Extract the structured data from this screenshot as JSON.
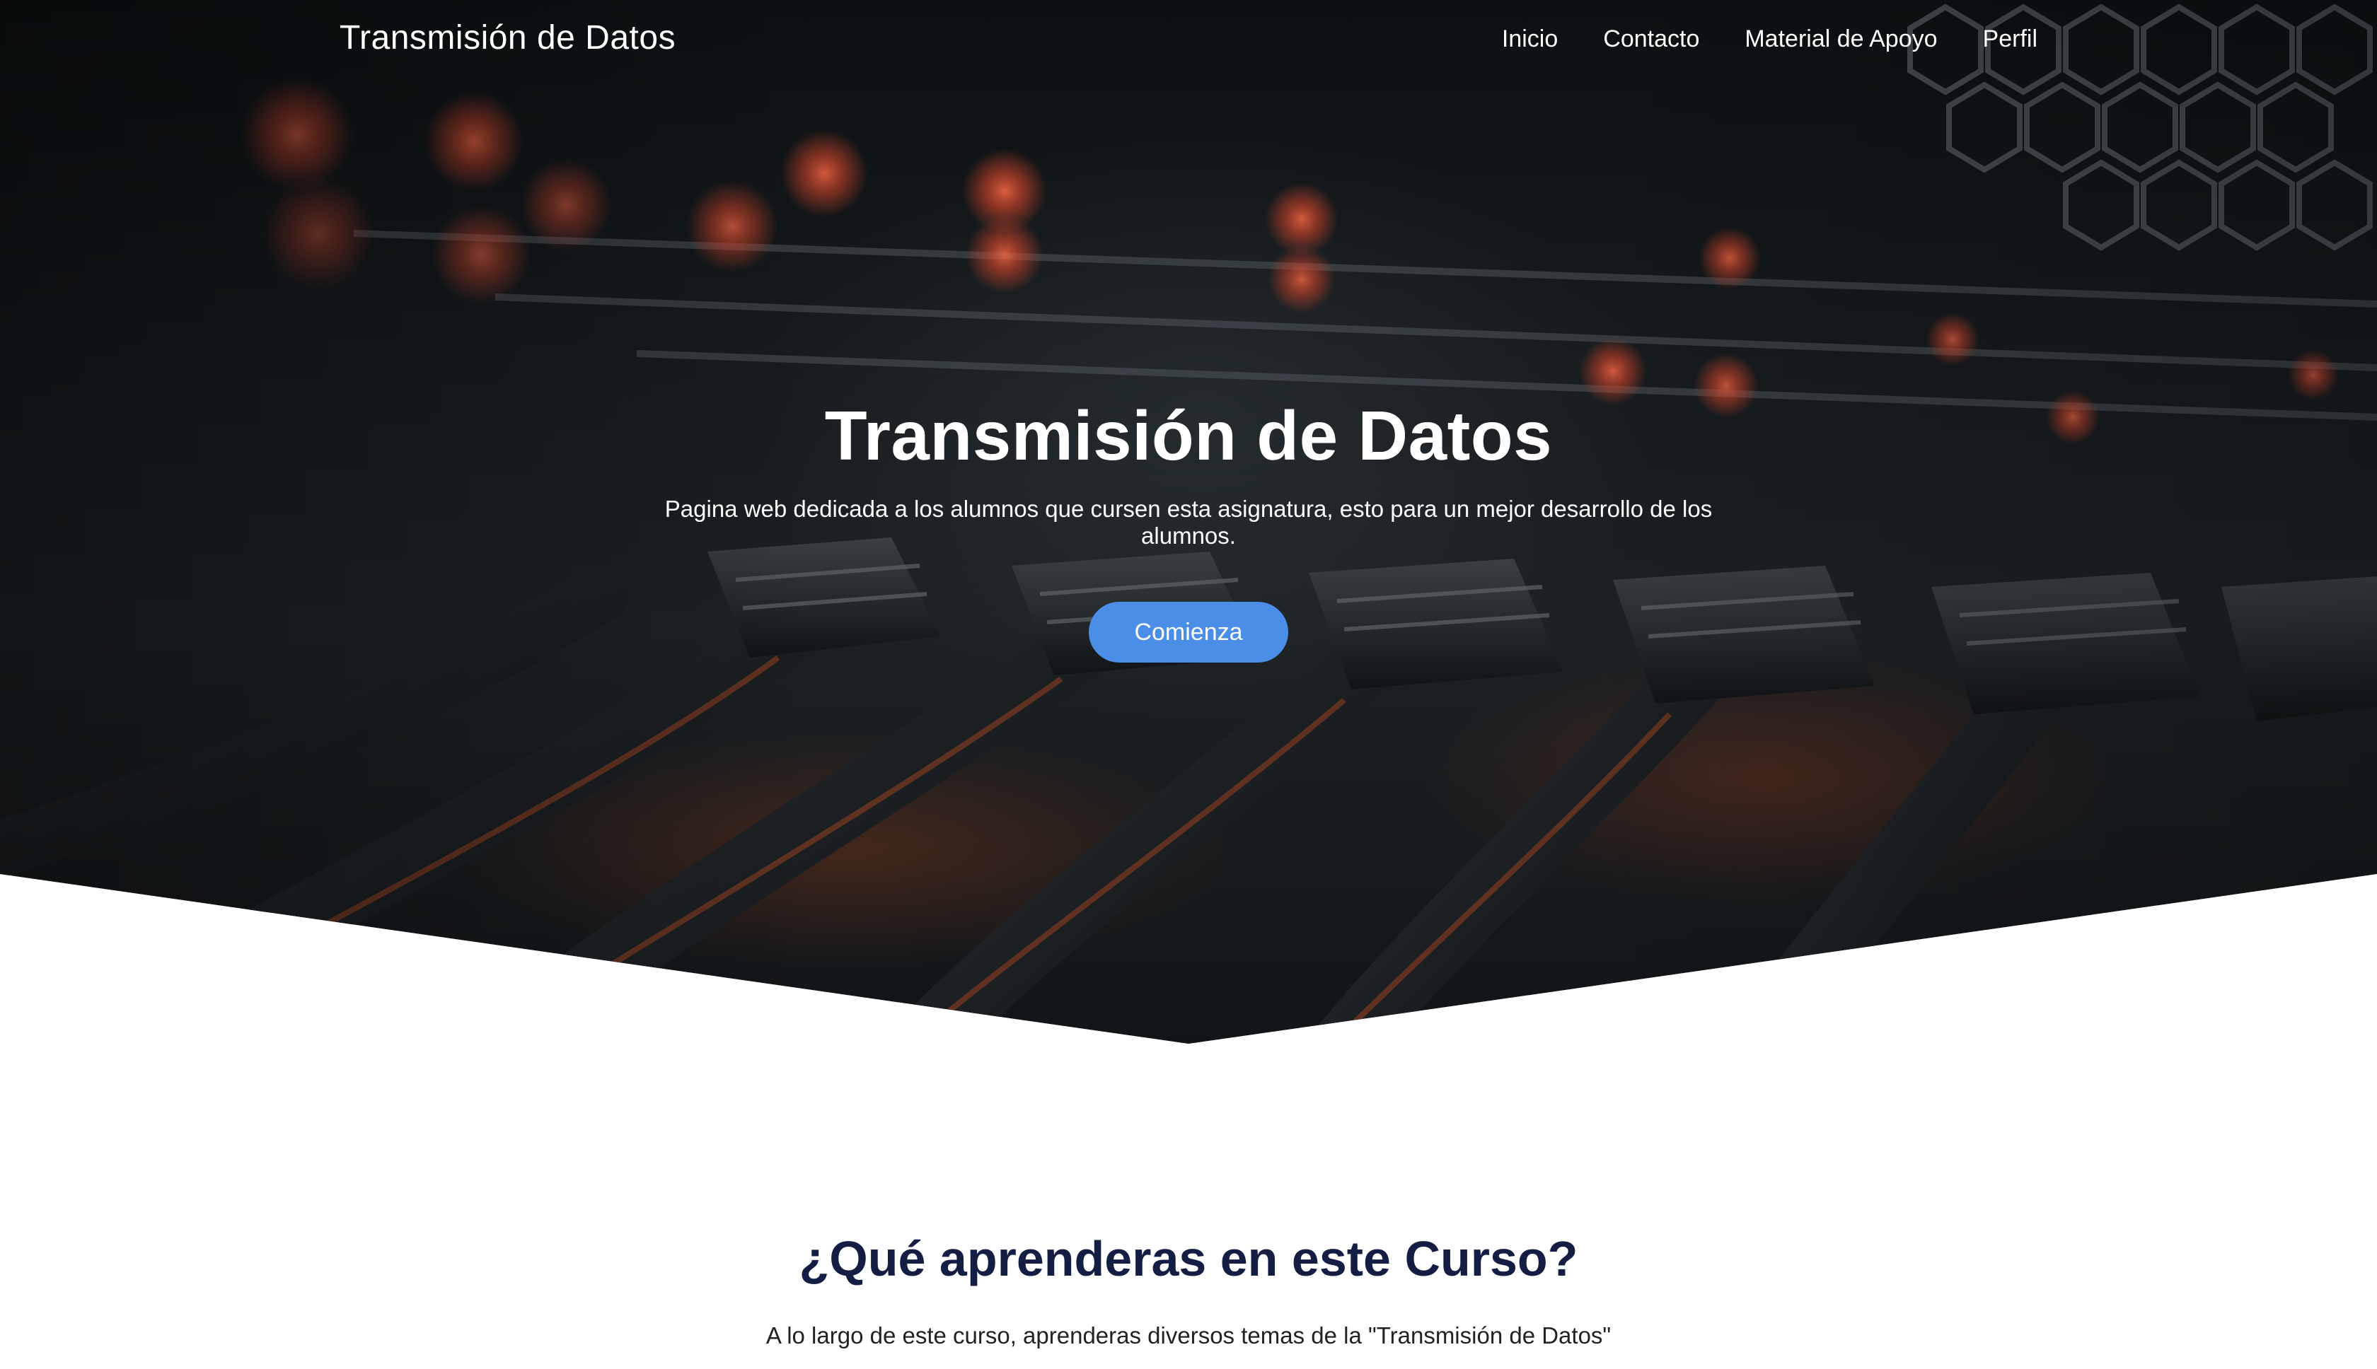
{
  "nav": {
    "brand": "Transmisión de Datos",
    "items": [
      {
        "label": "Inicio"
      },
      {
        "label": "Contacto"
      },
      {
        "label": "Material de Apoyo"
      },
      {
        "label": "Perfil"
      }
    ]
  },
  "hero": {
    "title": "Transmisión de Datos",
    "subtitle": "Pagina web dedicada a los alumnos que cursen esta asignatura, esto para un mejor desarrollo de los alumnos.",
    "cta_label": "Comienza",
    "colors": {
      "accent": "#4a8ee8",
      "glow": "#d9452a"
    }
  },
  "course": {
    "title": "¿Qué aprenderas en este Curso?",
    "description": "A lo largo de este curso, aprenderas diversos temas de la \"Transmisión de Datos\""
  }
}
